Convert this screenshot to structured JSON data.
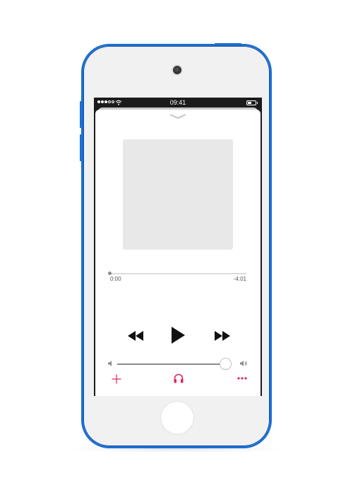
{
  "status_bar": {
    "time": "09:41",
    "icons": [
      "signal-dots-icon",
      "wifi-icon",
      "battery-icon"
    ]
  },
  "player": {
    "collapse_icon": "chevron-down-icon",
    "artwork": "album-artwork-placeholder",
    "progress": {
      "elapsed": "0:00",
      "remaining": "-4:01",
      "fraction": 0.0
    },
    "controls": {
      "rewind_icon": "rewind-icon",
      "play_icon": "play-icon",
      "fast_forward_icon": "fast-forward-icon"
    },
    "volume": {
      "level": 0.96,
      "min_icon": "speaker-low-icon",
      "max_icon": "speaker-high-icon"
    },
    "actions": {
      "add_icon": "plus-icon",
      "airplay_icon": "headphones-icon",
      "more_icon": "more-dots-icon"
    }
  },
  "colors": {
    "device_frame": "#1d6fd1",
    "accent": "#e0285a",
    "status_bar_bg": "#1b1b1b"
  }
}
